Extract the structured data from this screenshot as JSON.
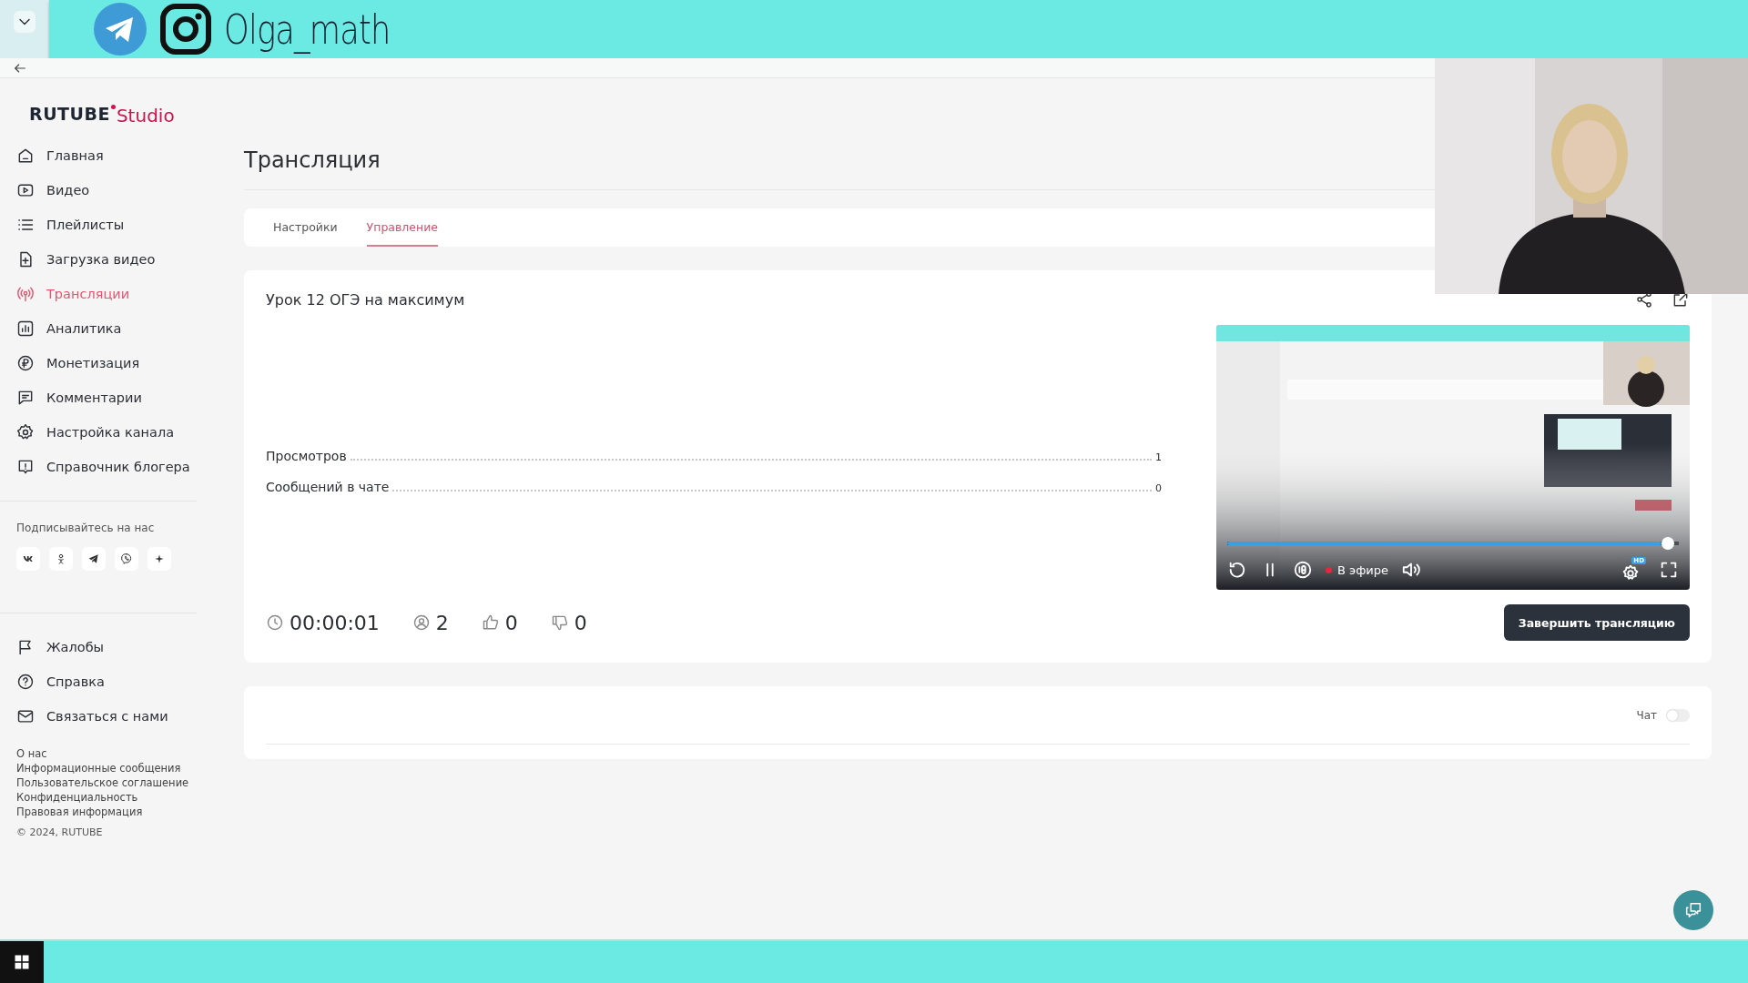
{
  "promo_banner": {
    "handle": "Olga_math"
  },
  "sidebar": {
    "logo": {
      "brand": "RUTUBE",
      "product": "Studio"
    },
    "items": [
      {
        "label": "Главная",
        "selected": false
      },
      {
        "label": "Видео",
        "selected": false
      },
      {
        "label": "Плейлисты",
        "selected": false
      },
      {
        "label": "Загрузка видео",
        "selected": false
      },
      {
        "label": "Трансляции",
        "selected": true
      },
      {
        "label": "Аналитика",
        "selected": false
      },
      {
        "label": "Монетизация",
        "selected": false
      },
      {
        "label": "Комментарии",
        "selected": false
      },
      {
        "label": "Настройка канала",
        "selected": false
      },
      {
        "label": "Справочник блогера",
        "selected": false
      }
    ],
    "subscribe_title": "Подписывайтесь на нас",
    "support_items": [
      "Жалобы",
      "Справка",
      "Связаться с нами"
    ],
    "footer_links": [
      "О нас",
      "Информационные сообщения",
      "Пользовательское соглашение",
      "Конфиденциальность",
      "Правовая информация"
    ],
    "copyright": "© 2024, RUTUBE"
  },
  "page_title": "Трансляция",
  "tabs": [
    {
      "label": "Настройки",
      "selected": false
    },
    {
      "label": "Управление",
      "selected": true
    }
  ],
  "stream": {
    "title": "Урок 12 ОГЭ на максимум",
    "stats": [
      {
        "label": "Просмотров",
        "value": "1"
      },
      {
        "label": "Сообщений в чате",
        "value": "0"
      }
    ],
    "counters": [
      {
        "kind": "duration",
        "value": "00:00:01"
      },
      {
        "kind": "viewers",
        "value": "2"
      },
      {
        "kind": "likes",
        "value": "0"
      },
      {
        "kind": "dislikes",
        "value": "0"
      }
    ],
    "player": {
      "level": 0.99,
      "live_label": "В эфире",
      "quality": "HD"
    },
    "end_button": "Завершить трансляцию"
  },
  "chat": {
    "label": "Чат",
    "on": false
  }
}
